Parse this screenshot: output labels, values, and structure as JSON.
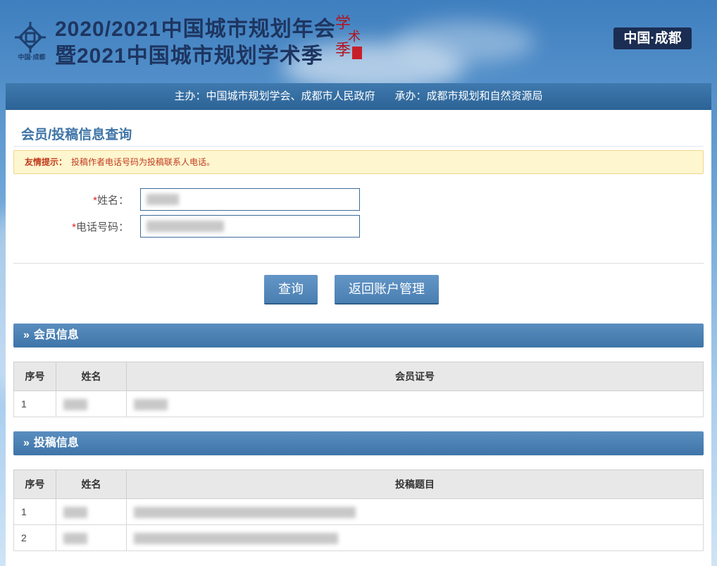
{
  "header": {
    "title_line1": "2020/2021中国城市规划年会",
    "title_line2": "暨2021中国城市规划学术季",
    "logo_caption": "中国·成都",
    "location_badge": "中国·成都",
    "seal_text": "学术季"
  },
  "sponsor_bar": {
    "host": "主办：中国城市规划学会、成都市人民政府",
    "organizer": "承办：成都市规划和自然资源局"
  },
  "page": {
    "title": "会员/投稿信息查询"
  },
  "notice": {
    "label": "友情提示：",
    "text": "投稿作者电话号码为投稿联系人电话。"
  },
  "form": {
    "name_required_mark": "*",
    "name_label": "姓名：",
    "phone_required_mark": "*",
    "phone_label": "电话号码："
  },
  "buttons": {
    "query": "查询",
    "back": "返回账户管理"
  },
  "member_section": {
    "title": "会员信息",
    "headers": [
      "序号",
      "姓名",
      "会员证号"
    ],
    "rows": [
      {
        "no": "1"
      }
    ]
  },
  "submission_section": {
    "title": "投稿信息",
    "headers": [
      "序号",
      "姓名",
      "投稿题目"
    ],
    "rows": [
      {
        "no": "1"
      },
      {
        "no": "2"
      }
    ]
  },
  "colors": {
    "accent": "#3e74a8",
    "header_title": "#1d3560",
    "notice_bg": "#fdf6cf",
    "notice_text": "#c13a1c"
  }
}
